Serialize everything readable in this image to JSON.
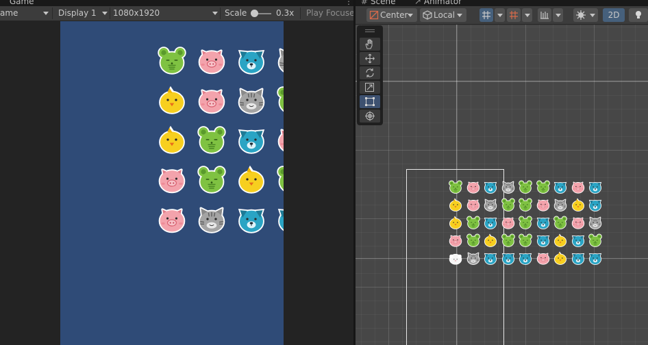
{
  "game_panel": {
    "tab_label": "Game",
    "toolbar": {
      "mode_dropdown": "ame",
      "display_dropdown": "Display 1",
      "resolution_dropdown": "1080x1920",
      "scale_label": "Scale",
      "scale_value": "0.3x",
      "play_focus_label": "Play Focuse"
    },
    "grid": [
      [
        "mouse",
        "pig",
        "dog",
        "cat"
      ],
      [
        "chick",
        "pig",
        "cat",
        "mouse"
      ],
      [
        "chick",
        "mouse",
        "dog",
        "pig"
      ],
      [
        "pig",
        "mouse",
        "chick",
        "mouse"
      ],
      [
        "pig",
        "cat",
        "dog",
        "dog"
      ]
    ]
  },
  "scene_panel": {
    "tab_scene": "Scene",
    "tab_animator": "Animator",
    "toolbar": {
      "pivot_dropdown": "Center",
      "space_dropdown": "Local",
      "view_2d_button": "2D"
    },
    "tools": [
      "hand-tool",
      "move-tool",
      "rotate-tool",
      "scale-tool",
      "rect-tool",
      "transform-tool"
    ],
    "active_tool": "rect-tool",
    "grid": [
      [
        "mouse",
        "pig",
        "dog",
        "cat",
        "mouse",
        "mouse",
        "dog",
        "pig",
        "dog"
      ],
      [
        "chick",
        "pig",
        "cat",
        "mouse",
        "mouse",
        "pig",
        "cat",
        "chick",
        "dog"
      ],
      [
        "chick",
        "mouse",
        "dog",
        "pig",
        "mouse",
        "dog",
        "mouse",
        "pig",
        "cat"
      ],
      [
        "pig",
        "mouse",
        "chick",
        "mouse",
        "mouse",
        "dog",
        "chick",
        "dog",
        "mouse"
      ],
      [
        "white",
        "cat",
        "dog",
        "dog",
        "dog",
        "pig",
        "chick",
        "dog",
        "dog"
      ]
    ]
  },
  "colors": {
    "game_background": "#2f4b77",
    "scene_background": "#474747",
    "toolbar_background": "#3c3c3c",
    "active_tool": "#3d5170"
  }
}
